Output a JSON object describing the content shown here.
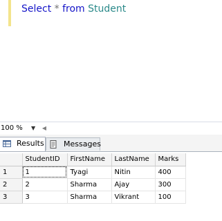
{
  "editor": {
    "query_tokens": {
      "kw_select": "Select",
      "star": "*",
      "kw_from": "from",
      "table": "Student"
    }
  },
  "zoom": {
    "value": "100 %"
  },
  "tabs": {
    "results_label": "Results",
    "messages_label": "Messages"
  },
  "grid": {
    "columns": [
      "",
      "StudentID",
      "FirstName",
      "LastName",
      "Marks"
    ],
    "rows": [
      {
        "num": "1",
        "cells": [
          "1",
          "Tyagi",
          "Nitin",
          "400"
        ]
      },
      {
        "num": "2",
        "cells": [
          "2",
          "Sharma",
          "Ajay",
          "300"
        ]
      },
      {
        "num": "3",
        "cells": [
          "3",
          "Sharma",
          "Vikrant",
          "100"
        ]
      }
    ]
  },
  "colors": {
    "keyword": "#1414c8",
    "table_name": "#2b8a8a",
    "margin_marker": "#f3e48c"
  },
  "icons": {
    "results": "grid-icon",
    "messages": "document-icon",
    "zoom": "chevron-down-icon",
    "scroll": "arrow-left-icon"
  }
}
